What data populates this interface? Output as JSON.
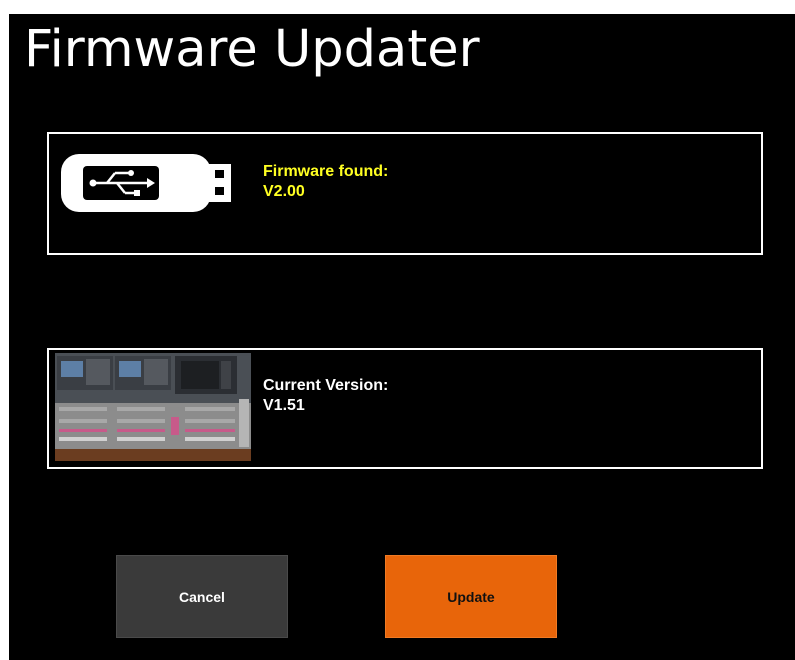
{
  "window": {
    "title": "Firmware Updater"
  },
  "found_panel": {
    "heading": "Firmware found:",
    "version": "V2.00",
    "icon": "usb-drive-icon",
    "text_color": "#ffff22"
  },
  "current_panel": {
    "heading": "Current Version:",
    "version": "V1.51",
    "icon": "mixing-console-image",
    "text_color": "#ffffff"
  },
  "buttons": {
    "cancel_label": "Cancel",
    "update_label": "Update",
    "cancel_color": "#3a3a3a",
    "update_color": "#e8650a"
  }
}
